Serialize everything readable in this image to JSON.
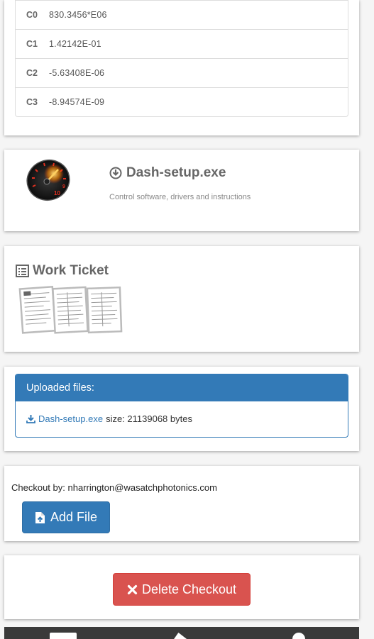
{
  "coefficients": [
    {
      "name": "C0",
      "value": "830.3456*E06"
    },
    {
      "name": "C1",
      "value": "1.42142E-01"
    },
    {
      "name": "C2",
      "value": "-5.63408E-06"
    },
    {
      "name": "C3",
      "value": "-8.94574E-09"
    }
  ],
  "download": {
    "title": "Dash-setup.exe",
    "description": "Control software, drivers and instructions",
    "icon": "download-circle-icon",
    "image": "speedometer-gauge-icon"
  },
  "ticket": {
    "title": "Work Ticket",
    "icon": "list-alt-icon"
  },
  "uploaded": {
    "heading": "Uploaded files:",
    "file_name": "Dash-setup.exe",
    "file_size": "size: 21139068 bytes"
  },
  "checkout": {
    "by_text": "Checkout by: nharrington@wasatchphotonics.com",
    "add_file_label": "Add File",
    "delete_label": "Delete Checkout"
  },
  "colors": {
    "primary": "#337ab7",
    "danger": "#d9534f",
    "nav_bg": "#3a3a3a"
  }
}
